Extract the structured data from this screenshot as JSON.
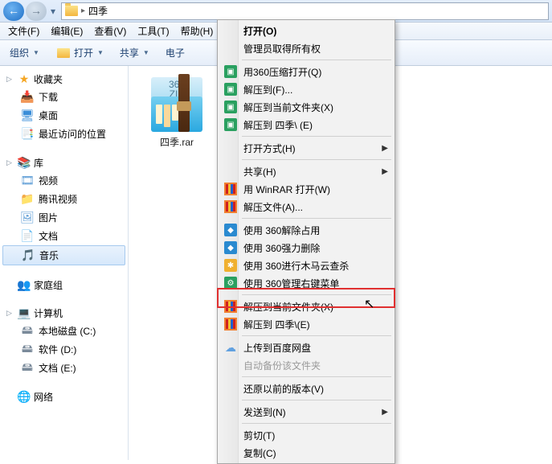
{
  "titlebar": {
    "path_name": "四季"
  },
  "menubar": {
    "file": "文件(F)",
    "edit": "编辑(E)",
    "view": "查看(V)",
    "tools": "工具(T)",
    "help": "帮助(H)"
  },
  "toolbar": {
    "organize": "组织",
    "open": "打开",
    "share": "共享",
    "email": "电子"
  },
  "sidebar": {
    "favorites": {
      "head": "收藏夹",
      "items": [
        "下载",
        "桌面",
        "最近访问的位置"
      ]
    },
    "libraries": {
      "head": "库",
      "items": [
        "视频",
        "腾讯视频",
        "图片",
        "文档",
        "音乐"
      ]
    },
    "homegroup": {
      "head": "家庭组"
    },
    "computer": {
      "head": "计算机",
      "items": [
        "本地磁盘 (C:)",
        "软件 (D:)",
        "文档 (E:)"
      ]
    },
    "network": {
      "head": "网络"
    }
  },
  "content": {
    "file": {
      "name": "四季.rar",
      "badge1": "360",
      "badge2": "ZIP"
    }
  },
  "ctx": {
    "open": "打开(O)",
    "admin": "管理员取得所有权",
    "open360": "用360压缩打开(Q)",
    "extract_to": "解压到(F)...",
    "extract_here": "解压到当前文件夹(X)",
    "extract_name": "解压到 四季\\ (E)",
    "open_with": "打开方式(H)",
    "share": "共享(H)",
    "winrar_open": "用 WinRAR 打开(W)",
    "extract_files": "解压文件(A)...",
    "use_360_release": "使用 360解除占用",
    "use_360_force": "使用 360强力删除",
    "use_360_scan": "使用 360进行木马云查杀",
    "use_360_menu": "使用 360管理右键菜单",
    "extract_here2": "解压到当前文件夹(X)",
    "extract_name2": "解压到 四季\\(E)",
    "upload_baidu": "上传到百度网盘",
    "auto_backup": "自动备份该文件夹",
    "restore": "还原以前的版本(V)",
    "send_to": "发送到(N)",
    "cut": "剪切(T)",
    "copy": "复制(C)"
  }
}
